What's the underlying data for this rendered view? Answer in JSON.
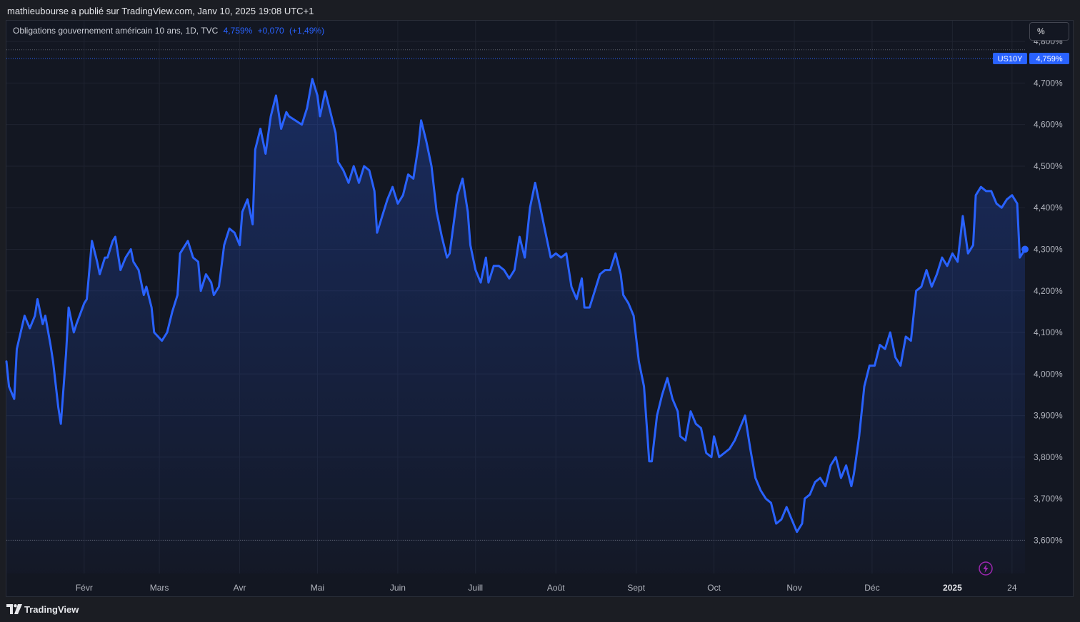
{
  "header": {
    "publisher": "mathieubourse a publié sur TradingView.com, Janv 10, 2025 19:08 UTC+1"
  },
  "legend": {
    "instrument": "Obligations gouvernement américain 10 ans, 1D, TVC",
    "last": "4,759%",
    "change": "+0,070",
    "change_pct": "(+1,49%)"
  },
  "toolbar": {
    "unit": "%"
  },
  "footer": {
    "brand": "TradingView"
  },
  "price_tag": {
    "ticker": "US10Y",
    "value": "4,759%"
  },
  "colors": {
    "line": "#2962ff",
    "background": "#131722",
    "grid": "#1f2330",
    "axis_text": "#b2b5be"
  },
  "chart_data": {
    "type": "area",
    "title": "Obligations gouvernement américain 10 ans, 1D, TVC",
    "ylim": [
      3.52,
      4.85
    ],
    "y_ticks": [
      3.6,
      3.7,
      3.8,
      3.9,
      4.0,
      4.1,
      4.2,
      4.3,
      4.4,
      4.5,
      4.6,
      4.7,
      4.8
    ],
    "y_tick_labels": [
      "3,600%",
      "3,700%",
      "3,800%",
      "3,900%",
      "4,000%",
      "4,100%",
      "4,200%",
      "4,300%",
      "4,400%",
      "4,500%",
      "4,600%",
      "4,700%",
      "4,800%"
    ],
    "x_ticks": [
      {
        "date": "2024-02-01",
        "label": "Févr",
        "bold": false
      },
      {
        "date": "2024-03-01",
        "label": "Mars",
        "bold": false
      },
      {
        "date": "2024-04-01",
        "label": "Avr",
        "bold": false
      },
      {
        "date": "2024-05-01",
        "label": "Mai",
        "bold": false
      },
      {
        "date": "2024-06-01",
        "label": "Juin",
        "bold": false
      },
      {
        "date": "2024-07-01",
        "label": "Juill",
        "bold": false
      },
      {
        "date": "2024-08-01",
        "label": "Août",
        "bold": false
      },
      {
        "date": "2024-09-01",
        "label": "Sept",
        "bold": false
      },
      {
        "date": "2024-10-01",
        "label": "Oct",
        "bold": false
      },
      {
        "date": "2024-11-01",
        "label": "Nov",
        "bold": false
      },
      {
        "date": "2024-12-01",
        "label": "Déc",
        "bold": false
      },
      {
        "date": "2025-01-01",
        "label": "2025",
        "bold": true
      },
      {
        "date": "2025-01-24",
        "label": "24",
        "bold": false
      }
    ],
    "xlim": [
      "2024-01-02",
      "2025-01-29"
    ],
    "reference_lines": [
      4.78,
      3.6
    ],
    "last_value": 4.759,
    "series": [
      {
        "name": "US10Y",
        "points": [
          [
            "2024-01-02",
            4.03
          ],
          [
            "2024-01-03",
            3.97
          ],
          [
            "2024-01-05",
            3.94
          ],
          [
            "2024-01-06",
            4.06
          ],
          [
            "2024-01-09",
            4.14
          ],
          [
            "2024-01-11",
            4.11
          ],
          [
            "2024-01-13",
            4.14
          ],
          [
            "2024-01-14",
            4.18
          ],
          [
            "2024-01-16",
            4.12
          ],
          [
            "2024-01-17",
            4.14
          ],
          [
            "2024-01-19",
            4.07
          ],
          [
            "2024-01-20",
            4.03
          ],
          [
            "2024-01-22",
            3.92
          ],
          [
            "2024-01-23",
            3.88
          ],
          [
            "2024-01-25",
            4.05
          ],
          [
            "2024-01-26",
            4.16
          ],
          [
            "2024-01-28",
            4.1
          ],
          [
            "2024-01-29",
            4.12
          ],
          [
            "2024-02-01",
            4.17
          ],
          [
            "2024-02-02",
            4.18
          ],
          [
            "2024-02-04",
            4.32
          ],
          [
            "2024-02-06",
            4.27
          ],
          [
            "2024-02-07",
            4.24
          ],
          [
            "2024-02-09",
            4.28
          ],
          [
            "2024-02-10",
            4.28
          ],
          [
            "2024-02-12",
            4.32
          ],
          [
            "2024-02-13",
            4.33
          ],
          [
            "2024-02-15",
            4.25
          ],
          [
            "2024-02-17",
            4.28
          ],
          [
            "2024-02-19",
            4.3
          ],
          [
            "2024-02-20",
            4.27
          ],
          [
            "2024-02-22",
            4.25
          ],
          [
            "2024-02-24",
            4.19
          ],
          [
            "2024-02-25",
            4.21
          ],
          [
            "2024-02-27",
            4.16
          ],
          [
            "2024-02-28",
            4.1
          ],
          [
            "2024-03-02",
            4.08
          ],
          [
            "2024-03-04",
            4.1
          ],
          [
            "2024-03-06",
            4.15
          ],
          [
            "2024-03-08",
            4.19
          ],
          [
            "2024-03-09",
            4.29
          ],
          [
            "2024-03-12",
            4.32
          ],
          [
            "2024-03-14",
            4.28
          ],
          [
            "2024-03-16",
            4.27
          ],
          [
            "2024-03-17",
            4.2
          ],
          [
            "2024-03-19",
            4.24
          ],
          [
            "2024-03-21",
            4.22
          ],
          [
            "2024-03-22",
            4.19
          ],
          [
            "2024-03-24",
            4.21
          ],
          [
            "2024-03-26",
            4.31
          ],
          [
            "2024-03-28",
            4.35
          ],
          [
            "2024-03-30",
            4.34
          ],
          [
            "2024-04-01",
            4.31
          ],
          [
            "2024-04-02",
            4.39
          ],
          [
            "2024-04-04",
            4.42
          ],
          [
            "2024-04-06",
            4.36
          ],
          [
            "2024-04-07",
            4.54
          ],
          [
            "2024-04-09",
            4.59
          ],
          [
            "2024-04-11",
            4.53
          ],
          [
            "2024-04-13",
            4.62
          ],
          [
            "2024-04-15",
            4.67
          ],
          [
            "2024-04-17",
            4.59
          ],
          [
            "2024-04-19",
            4.63
          ],
          [
            "2024-04-20",
            4.62
          ],
          [
            "2024-04-25",
            4.6
          ],
          [
            "2024-04-27",
            4.64
          ],
          [
            "2024-04-29",
            4.71
          ],
          [
            "2024-05-01",
            4.67
          ],
          [
            "2024-05-02",
            4.62
          ],
          [
            "2024-05-04",
            4.68
          ],
          [
            "2024-05-06",
            4.63
          ],
          [
            "2024-05-08",
            4.58
          ],
          [
            "2024-05-09",
            4.51
          ],
          [
            "2024-05-11",
            4.49
          ],
          [
            "2024-05-13",
            4.46
          ],
          [
            "2024-05-15",
            4.5
          ],
          [
            "2024-05-17",
            4.46
          ],
          [
            "2024-05-19",
            4.5
          ],
          [
            "2024-05-21",
            4.49
          ],
          [
            "2024-05-23",
            4.44
          ],
          [
            "2024-05-24",
            4.34
          ],
          [
            "2024-05-26",
            4.38
          ],
          [
            "2024-05-28",
            4.42
          ],
          [
            "2024-05-30",
            4.45
          ],
          [
            "2024-06-01",
            4.41
          ],
          [
            "2024-06-03",
            4.43
          ],
          [
            "2024-06-05",
            4.48
          ],
          [
            "2024-06-07",
            4.47
          ],
          [
            "2024-06-09",
            4.55
          ],
          [
            "2024-06-10",
            4.61
          ],
          [
            "2024-06-12",
            4.56
          ],
          [
            "2024-06-14",
            4.5
          ],
          [
            "2024-06-16",
            4.39
          ],
          [
            "2024-06-18",
            4.33
          ],
          [
            "2024-06-20",
            4.28
          ],
          [
            "2024-06-21",
            4.29
          ],
          [
            "2024-06-24",
            4.43
          ],
          [
            "2024-06-26",
            4.47
          ],
          [
            "2024-06-28",
            4.39
          ],
          [
            "2024-06-29",
            4.31
          ],
          [
            "2024-07-01",
            4.25
          ],
          [
            "2024-07-03",
            4.22
          ],
          [
            "2024-07-05",
            4.28
          ],
          [
            "2024-07-06",
            4.22
          ],
          [
            "2024-07-08",
            4.26
          ],
          [
            "2024-07-10",
            4.26
          ],
          [
            "2024-07-12",
            4.25
          ],
          [
            "2024-07-14",
            4.23
          ],
          [
            "2024-07-16",
            4.25
          ],
          [
            "2024-07-18",
            4.33
          ],
          [
            "2024-07-20",
            4.28
          ],
          [
            "2024-07-22",
            4.4
          ],
          [
            "2024-07-24",
            4.46
          ],
          [
            "2024-07-26",
            4.4
          ],
          [
            "2024-07-28",
            4.34
          ],
          [
            "2024-07-30",
            4.28
          ],
          [
            "2024-08-01",
            4.29
          ],
          [
            "2024-08-03",
            4.28
          ],
          [
            "2024-08-05",
            4.29
          ],
          [
            "2024-08-07",
            4.21
          ],
          [
            "2024-08-09",
            4.18
          ],
          [
            "2024-08-11",
            4.23
          ],
          [
            "2024-08-12",
            4.16
          ],
          [
            "2024-08-14",
            4.16
          ],
          [
            "2024-08-16",
            4.2
          ],
          [
            "2024-08-18",
            4.24
          ],
          [
            "2024-08-20",
            4.25
          ],
          [
            "2024-08-22",
            4.25
          ],
          [
            "2024-08-24",
            4.29
          ],
          [
            "2024-08-26",
            4.24
          ],
          [
            "2024-08-27",
            4.19
          ],
          [
            "2024-08-29",
            4.17
          ],
          [
            "2024-08-31",
            4.14
          ],
          [
            "2024-09-02",
            4.03
          ],
          [
            "2024-09-04",
            3.97
          ],
          [
            "2024-09-06",
            3.79
          ],
          [
            "2024-09-07",
            3.79
          ],
          [
            "2024-09-09",
            3.9
          ],
          [
            "2024-09-11",
            3.95
          ],
          [
            "2024-09-13",
            3.99
          ],
          [
            "2024-09-15",
            3.94
          ],
          [
            "2024-09-17",
            3.91
          ],
          [
            "2024-09-18",
            3.85
          ],
          [
            "2024-09-20",
            3.84
          ],
          [
            "2024-09-22",
            3.91
          ],
          [
            "2024-09-24",
            3.88
          ],
          [
            "2024-09-26",
            3.87
          ],
          [
            "2024-09-28",
            3.81
          ],
          [
            "2024-09-30",
            3.8
          ],
          [
            "2024-10-01",
            3.85
          ],
          [
            "2024-10-03",
            3.8
          ],
          [
            "2024-10-05",
            3.81
          ],
          [
            "2024-10-07",
            3.82
          ],
          [
            "2024-10-09",
            3.84
          ],
          [
            "2024-10-11",
            3.87
          ],
          [
            "2024-10-13",
            3.9
          ],
          [
            "2024-10-15",
            3.82
          ],
          [
            "2024-10-17",
            3.75
          ],
          [
            "2024-10-19",
            3.72
          ],
          [
            "2024-10-21",
            3.7
          ],
          [
            "2024-10-23",
            3.69
          ],
          [
            "2024-10-25",
            3.64
          ],
          [
            "2024-10-27",
            3.65
          ],
          [
            "2024-10-29",
            3.68
          ],
          [
            "2024-10-31",
            3.65
          ],
          [
            "2024-11-02",
            3.62
          ],
          [
            "2024-11-04",
            3.64
          ],
          [
            "2024-11-05",
            3.7
          ],
          [
            "2024-11-07",
            3.71
          ],
          [
            "2024-11-09",
            3.74
          ],
          [
            "2024-11-11",
            3.75
          ],
          [
            "2024-11-13",
            3.73
          ],
          [
            "2024-11-15",
            3.78
          ],
          [
            "2024-11-17",
            3.8
          ],
          [
            "2024-11-19",
            3.75
          ],
          [
            "2024-11-21",
            3.78
          ],
          [
            "2024-11-23",
            3.73
          ],
          [
            "2024-11-24",
            3.76
          ],
          [
            "2024-11-26",
            3.85
          ],
          [
            "2024-11-28",
            3.97
          ],
          [
            "2024-11-30",
            4.02
          ],
          [
            "2024-12-02",
            4.02
          ],
          [
            "2024-12-04",
            4.07
          ],
          [
            "2024-12-06",
            4.06
          ],
          [
            "2024-12-08",
            4.1
          ],
          [
            "2024-12-10",
            4.04
          ],
          [
            "2024-12-12",
            4.02
          ],
          [
            "2024-12-14",
            4.09
          ],
          [
            "2024-12-16",
            4.08
          ],
          [
            "2024-12-18",
            4.2
          ],
          [
            "2024-12-20",
            4.21
          ],
          [
            "2024-12-22",
            4.25
          ],
          [
            "2024-12-24",
            4.21
          ],
          [
            "2024-12-26",
            4.24
          ],
          [
            "2024-12-28",
            4.28
          ],
          [
            "2024-12-30",
            4.26
          ],
          [
            "2025-01-01",
            4.29
          ],
          [
            "2025-01-03",
            4.27
          ],
          [
            "2025-01-05",
            4.38
          ],
          [
            "2025-01-07",
            4.29
          ],
          [
            "2025-01-09",
            4.31
          ],
          [
            "2025-01-10",
            4.43
          ],
          [
            "2025-01-12",
            4.45
          ],
          [
            "2025-01-14",
            4.44
          ],
          [
            "2025-01-16",
            4.44
          ],
          [
            "2025-01-18",
            4.41
          ],
          [
            "2025-01-20",
            4.4
          ],
          [
            "2025-01-22",
            4.42
          ],
          [
            "2025-01-24",
            4.43
          ],
          [
            "2025-01-26",
            4.41
          ],
          [
            "2025-01-27",
            4.28
          ],
          [
            "2025-01-29",
            4.3
          ]
        ]
      }
    ]
  }
}
